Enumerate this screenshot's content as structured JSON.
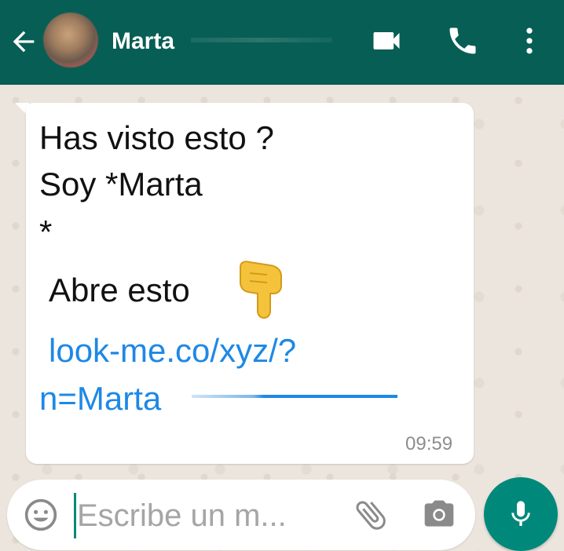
{
  "header": {
    "contact_name": "Marta",
    "icons": [
      "back-arrow-icon",
      "avatar",
      "video-call-icon",
      "phone-icon",
      "more-vert-icon"
    ]
  },
  "message": {
    "lines": [
      "Has visto esto ?",
      "Soy *Marta",
      "*",
      " Abre esto"
    ],
    "emoji": "point-down-hand-icon",
    "link_lines": [
      "look-me.co/xyz/?",
      "n=Marta"
    ],
    "time": "09:59"
  },
  "composer": {
    "placeholder": "Escribe un m..."
  },
  "colors": {
    "header": "#075e54",
    "accent": "#00897b",
    "link": "#1e88e5",
    "chat_bg": "#ece5dd"
  }
}
